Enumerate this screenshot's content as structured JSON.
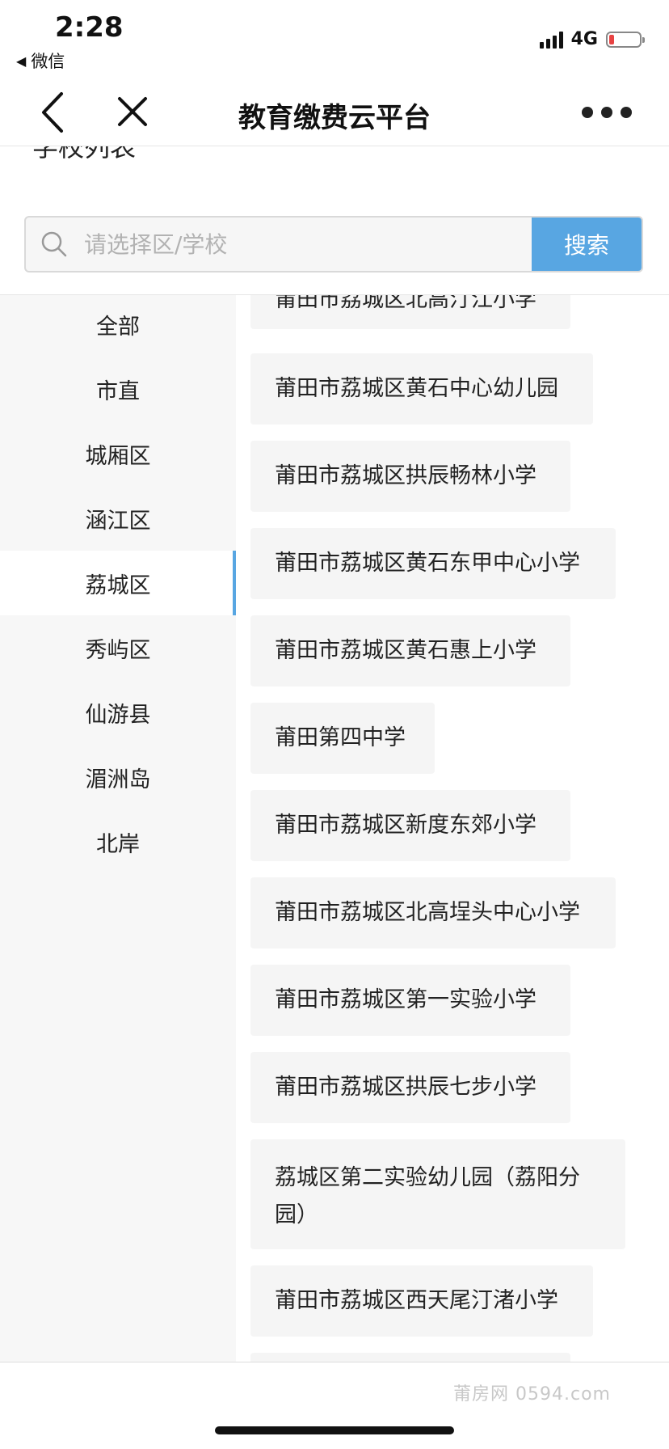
{
  "status": {
    "time": "2:28",
    "back_app": "微信",
    "network": "4G"
  },
  "nav": {
    "title": "教育缴费云平台"
  },
  "header": {
    "partial_title": "学校列表"
  },
  "search": {
    "placeholder": "请选择区/学校",
    "button_label": "搜索"
  },
  "districts": [
    {
      "label": "全部",
      "active": false
    },
    {
      "label": "市直",
      "active": false
    },
    {
      "label": "城厢区",
      "active": false
    },
    {
      "label": "涵江区",
      "active": false
    },
    {
      "label": "荔城区",
      "active": true
    },
    {
      "label": "秀屿区",
      "active": false
    },
    {
      "label": "仙游县",
      "active": false
    },
    {
      "label": "湄洲岛",
      "active": false
    },
    {
      "label": "北岸",
      "active": false
    }
  ],
  "schools": [
    "莆田市荔城区北高汀江小学",
    "莆田市荔城区黄石中心幼儿园",
    "莆田市荔城区拱辰畅林小学",
    "莆田市荔城区黄石东甲中心小学",
    "莆田市荔城区黄石惠上小学",
    "莆田第四中学",
    "莆田市荔城区新度东郊小学",
    "莆田市荔城区北高埕头中心小学",
    "莆田市荔城区第一实验小学",
    "莆田市荔城区拱辰七步小学",
    "荔城区第二实验幼儿园（荔阳分园）",
    "莆田市荔城区西天尾汀渚小学"
  ],
  "watermark": "莆房网 0594.com",
  "colors": {
    "accent": "#58a6e2",
    "battery_low": "#e84343"
  }
}
